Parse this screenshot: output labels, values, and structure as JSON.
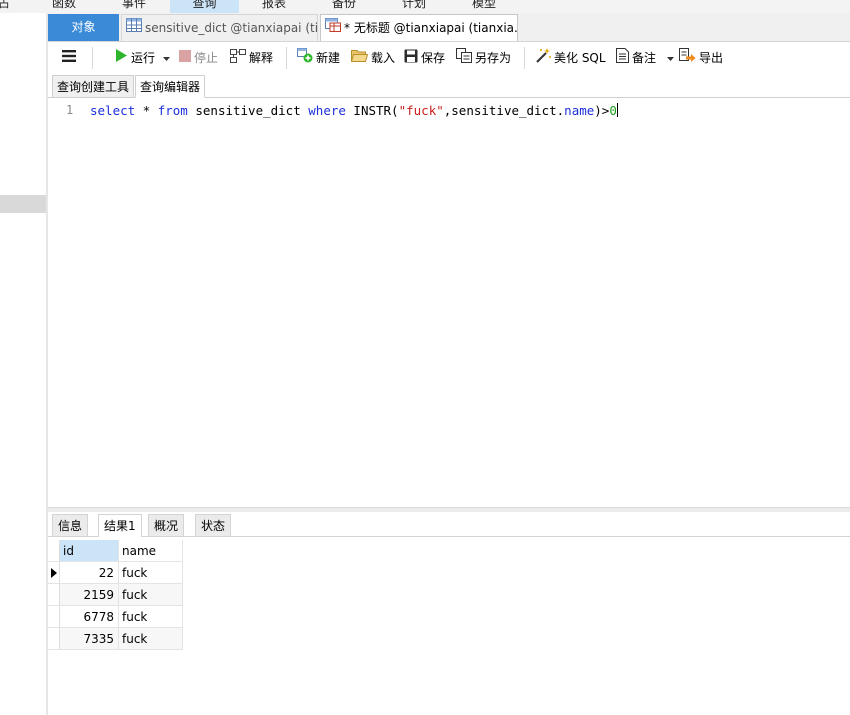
{
  "menu": {
    "items": [
      {
        "label": "函数"
      },
      {
        "label": "事件"
      },
      {
        "label": "查询",
        "active": true
      },
      {
        "label": "报表"
      },
      {
        "label": "备份"
      },
      {
        "label": "计划"
      },
      {
        "label": "模型"
      }
    ],
    "cut_label": "占"
  },
  "tabs": {
    "objects": "对象",
    "table_tab": "sensitive_dict @tianxiapai (ti...",
    "query_tab": "* 无标题 @tianxiapai (tianxia..."
  },
  "toolbar": {
    "run": "运行",
    "stop": "停止",
    "explain": "解释",
    "new": "新建",
    "load": "载入",
    "save": "保存",
    "save_as": "另存为",
    "beautify": "美化 SQL",
    "comment": "备注",
    "export": "导出"
  },
  "subtabs": {
    "builder": "查询创建工具",
    "editor": "查询编辑器"
  },
  "editor": {
    "line_number": "1",
    "sql": {
      "kw_select": "select",
      "star": " * ",
      "kw_from": "from",
      "table": " sensitive_dict ",
      "kw_where": "where",
      "func": " INSTR(",
      "str": "\"fuck\"",
      "comma_table": ",sensitive_dict.",
      "field": "name",
      "close_gt": ")>",
      "num": "0"
    }
  },
  "result_tabs": [
    "信息",
    "结果1",
    "概况",
    "状态"
  ],
  "grid": {
    "columns": [
      "id",
      "name"
    ],
    "rows": [
      {
        "id": "22",
        "name": "fuck"
      },
      {
        "id": "2159",
        "name": "fuck"
      },
      {
        "id": "6778",
        "name": "fuck"
      },
      {
        "id": "7335",
        "name": "fuck"
      }
    ]
  },
  "colors": {
    "active_tab": "#3a8ad8",
    "keyword": "#1c2fdc",
    "string": "#c9211e",
    "number": "#1aa01a",
    "header_selected": "#cce4f7"
  }
}
